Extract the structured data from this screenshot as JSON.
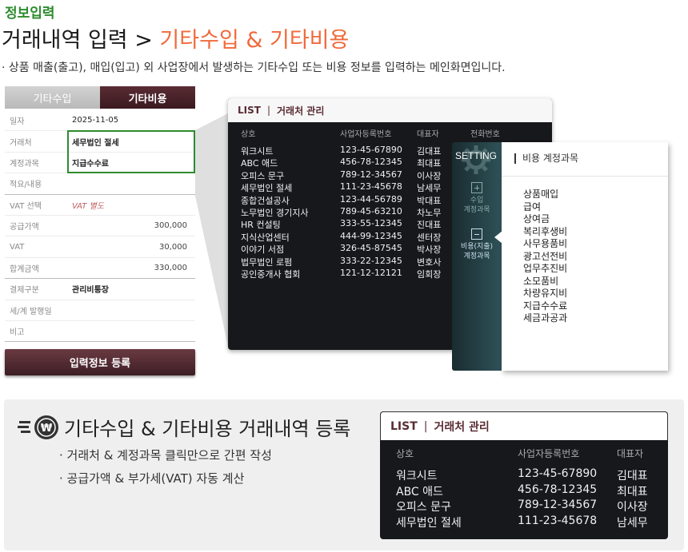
{
  "header": {
    "section_label": "정보입력",
    "title_main": "거래내역 입력 > ",
    "title_accent": "기타수입 & 기타비용",
    "description": "· 상품 매출(출고), 매입(입고) 외 사업장에서 발생하는 기타수입 또는 비용 정보를 입력하는 메인화면입니다."
  },
  "tabs": [
    {
      "label": "기타수입",
      "active": false
    },
    {
      "label": "기타비용",
      "active": true
    }
  ],
  "form": {
    "rows": [
      {
        "label": "일자",
        "value": "2025-11-05"
      },
      {
        "label": "거래처",
        "value": "세무법인 절세"
      },
      {
        "label": "계정과목",
        "value": "지급수수료"
      },
      {
        "label": "적요/내용",
        "value": ""
      },
      {
        "label": "VAT 선택",
        "value": "VAT 별도"
      },
      {
        "label": "공급가액",
        "value": "300,000"
      },
      {
        "label": "VAT",
        "value": "30,000"
      },
      {
        "label": "합계금액",
        "value": "330,000"
      },
      {
        "label": "결제구분",
        "value": "관리비통장"
      },
      {
        "label": "세/계 발행일",
        "value": ""
      },
      {
        "label": "비고",
        "value": ""
      }
    ],
    "submit_label": "입력정보 등록"
  },
  "list_panel": {
    "title": "LIST",
    "separator": "|",
    "subtitle": "거래처 관리",
    "columns": [
      "상호",
      "사업자등록번호",
      "대표자",
      "전화번호"
    ],
    "rows": [
      [
        "워크시트",
        "123-45-67890",
        "김대표"
      ],
      [
        "ABC 애드",
        "456-78-12345",
        "최대표"
      ],
      [
        "오피스 문구",
        "789-12-34567",
        "이사장"
      ],
      [
        "세무법인 절세",
        "111-23-45678",
        "남세무"
      ],
      [
        "종합건설공사",
        "123-44-56789",
        "박대표"
      ],
      [
        "노무법인 경기지사",
        "789-45-63210",
        "차노무"
      ],
      [
        "HR 컨설팅",
        "333-55-12345",
        "진대표"
      ],
      [
        "지식산업센터",
        "444-99-12345",
        "센터장"
      ],
      [
        "이야기 서점",
        "326-45-87545",
        "박사장"
      ],
      [
        "법무법인 로펌",
        "333-22-12345",
        "변호사"
      ],
      [
        "공인중개사 협회",
        "121-12-12121",
        "임회장"
      ]
    ]
  },
  "setting_panel": {
    "title": "SETTING",
    "buttons": [
      {
        "label_line1": "수입",
        "label_line2": "계정과목",
        "icon": "plus-square-icon",
        "active": false
      },
      {
        "label_line1": "비용(지출)",
        "label_line2": "계정과목",
        "icon": "minus-square-icon",
        "active": true
      }
    ]
  },
  "account_panel": {
    "title": "비용 계정과목",
    "items": [
      "상품매입",
      "급여",
      "상여금",
      "복리후생비",
      "사무용품비",
      "광고선전비",
      "업무추진비",
      "소모품비",
      "차량유지비",
      "지급수수료",
      "세금과공과"
    ]
  },
  "feature": {
    "title": "기타수입 & 기타비용 거래내역 등록",
    "items": [
      "· 거래처 & 계정과목 클릭만으로 간편 작성",
      "· 공급가액 & 부가세(VAT) 자동 계산"
    ]
  },
  "mini_panel": {
    "title": "LIST",
    "separator": "|",
    "subtitle": "거래처 관리",
    "columns": [
      "상호",
      "사업자등록번호",
      "대표자"
    ],
    "rows": [
      [
        "워크시트",
        "123-45-67890",
        "김대표"
      ],
      [
        "ABC 애드",
        "456-78-12345",
        "최대표"
      ],
      [
        "오피스 문구",
        "789-12-34567",
        "이사장"
      ],
      [
        "세무법인 절세",
        "111-23-45678",
        "남세무"
      ]
    ]
  },
  "colors": {
    "accent": "#f06a3b",
    "section_green": "#2e8b2e",
    "brand_maroon": "#5a2c34"
  }
}
